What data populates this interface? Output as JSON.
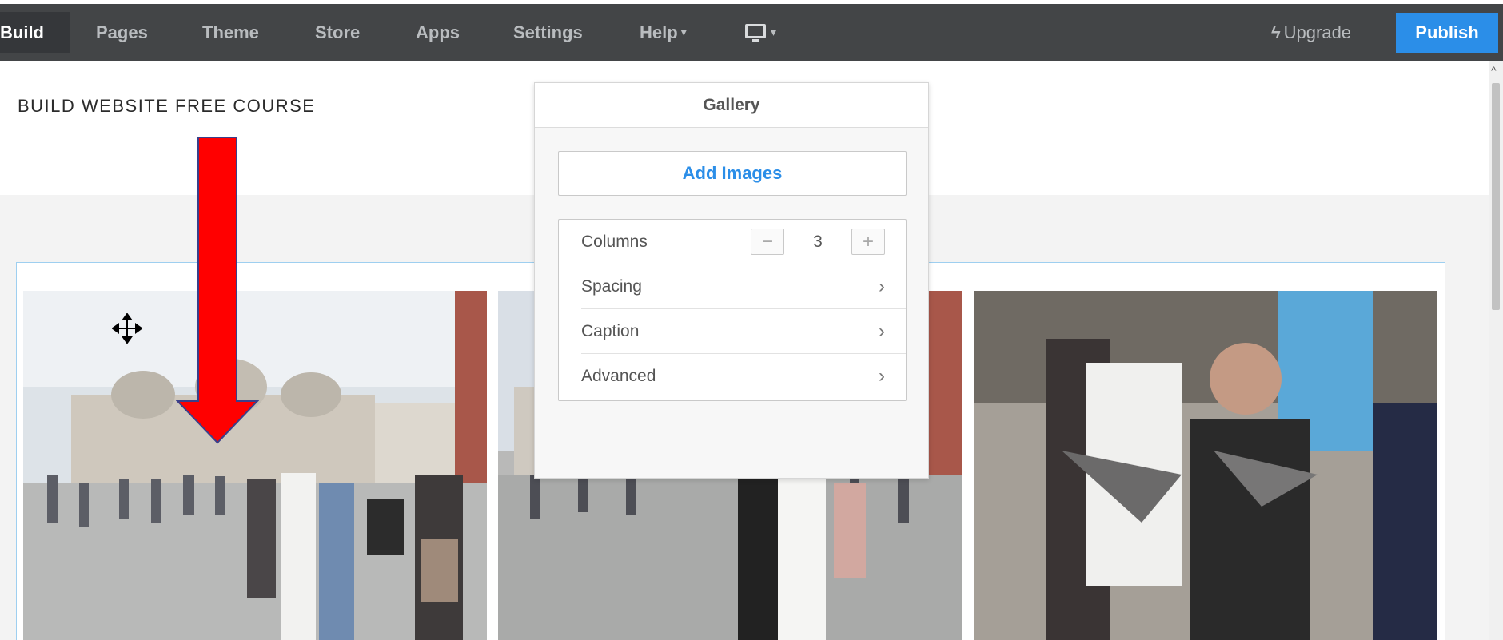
{
  "topbar": {
    "nav": [
      {
        "label": "Build",
        "active": true
      },
      {
        "label": "Pages"
      },
      {
        "label": "Theme"
      },
      {
        "label": "Store"
      },
      {
        "label": "Apps"
      },
      {
        "label": "Settings"
      },
      {
        "label": "Help"
      }
    ],
    "upgrade_label": "Upgrade",
    "publish_label": "Publish",
    "colors": {
      "bar": "#434547",
      "publish": "#2b8ee8"
    }
  },
  "site": {
    "title": "BUILD WEBSITE FREE COURSE"
  },
  "gallery_panel": {
    "title": "Gallery",
    "add_images_label": "Add Images",
    "columns": {
      "label": "Columns",
      "value": "3"
    },
    "rows": [
      {
        "label": "Spacing"
      },
      {
        "label": "Caption"
      },
      {
        "label": "Advanced"
      }
    ]
  },
  "icons": {
    "device": "monitor-icon",
    "upgrade": "lightning-icon",
    "chevron": "chevron-right-icon",
    "cursor": "move-cursor-icon"
  },
  "annotation": {
    "arrow_color": "#ff0000"
  }
}
